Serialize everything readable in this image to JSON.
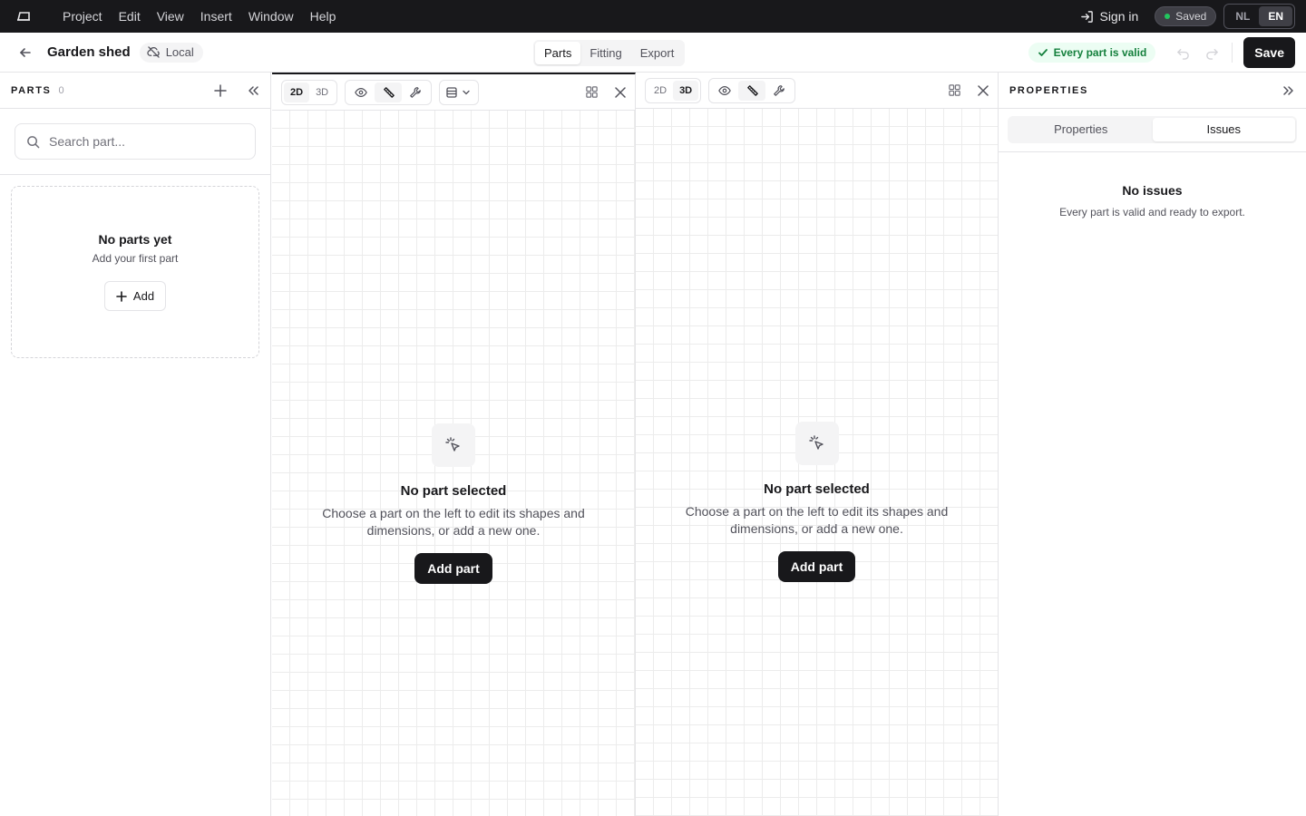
{
  "menubar": {
    "logo": "shed-logo-icon",
    "items": [
      "Project",
      "Edit",
      "View",
      "Insert",
      "Window",
      "Help"
    ],
    "sign_in": "Sign in",
    "saved": "Saved",
    "languages": [
      "NL",
      "EN"
    ],
    "active_language": "EN"
  },
  "toolbar": {
    "project_title": "Garden shed",
    "location_badge": "Local",
    "mode_tabs": [
      "Parts",
      "Fitting",
      "Export"
    ],
    "active_mode": "Parts",
    "validation": "Every part is valid",
    "save_label": "Save"
  },
  "parts_panel": {
    "title": "PARTS",
    "count": "0",
    "search_placeholder": "Search part...",
    "empty_title": "No parts yet",
    "empty_subtitle": "Add your first part",
    "add_label": "Add"
  },
  "viewports": [
    {
      "modes": [
        "2D",
        "3D"
      ],
      "active_mode": "2D",
      "empty_title": "No part selected",
      "empty_text": "Choose a part on the left to edit its shapes and dimensions, or add a new one.",
      "add_part_label": "Add part"
    },
    {
      "modes": [
        "2D",
        "3D"
      ],
      "active_mode": "3D",
      "empty_title": "No part selected",
      "empty_text": "Choose a part on the left to edit its shapes and dimensions, or add a new one.",
      "add_part_label": "Add part"
    }
  ],
  "properties_panel": {
    "title": "PROPERTIES",
    "tabs": [
      "Properties",
      "Issues"
    ],
    "active_tab": "Issues",
    "empty_title": "No issues",
    "empty_text": "Every part is valid and ready to export."
  },
  "colors": {
    "dark": "#18181b",
    "valid_green": "#15803d",
    "valid_bg": "#ecfdf3",
    "saved_dot": "#22c55e"
  }
}
